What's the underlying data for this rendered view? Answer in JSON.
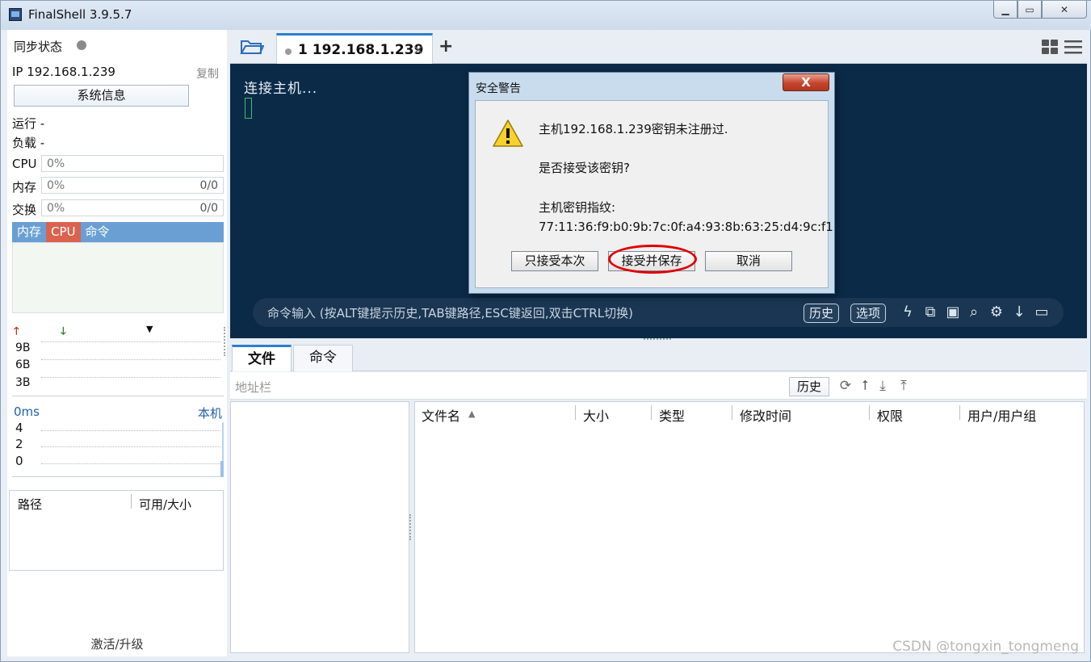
{
  "window": {
    "title": "FinalShell 3.9.5.7",
    "min_icon": "minimize-icon",
    "max_icon": "maximize-icon",
    "close_icon": "close-icon"
  },
  "sidebar": {
    "sync_label": "同步状态",
    "ip": "IP 192.168.1.239",
    "copy": "复制",
    "sysinfo_button": "系统信息",
    "run": "运行 -",
    "load": "负载 -",
    "meters": [
      {
        "label": "CPU",
        "pct": "0%",
        "ratio": ""
      },
      {
        "label": "内存",
        "pct": "0%",
        "ratio": "0/0"
      },
      {
        "label": "交换",
        "pct": "0%",
        "ratio": "0/0"
      }
    ],
    "proc_tabs": [
      "内存",
      "CPU",
      "命令"
    ],
    "net_yticks": [
      "9B",
      "6B",
      "3B"
    ],
    "ping_ms": "0ms",
    "ping_host": "本机",
    "ping_yticks": [
      "4",
      "2",
      "0"
    ],
    "disk_headers": [
      "路径",
      "可用/大小"
    ],
    "activate": "激活/升级"
  },
  "tabs": {
    "session_label": "1 192.168.1.239",
    "close": "×",
    "add": "+"
  },
  "terminal": {
    "text": "连接主机...",
    "cmd_placeholder": "命令输入 (按ALT键提示历史,TAB键路径,ESC键返回,双击CTRL切换)",
    "history_button": "历史",
    "options_button": "选项"
  },
  "bottom_tabs": [
    "文件",
    "命令"
  ],
  "address": {
    "placeholder": "地址栏",
    "history_button": "历史"
  },
  "file_columns": [
    "文件名",
    "大小",
    "类型",
    "修改时间",
    "权限",
    "用户/用户组"
  ],
  "watermark": "CSDN @tongxin_tongmeng",
  "dialog": {
    "title": "安全警告",
    "close": "X",
    "line1": "主机192.168.1.239密钥未注册过.",
    "line2": "是否接受该密钥?",
    "line3": "主机密钥指纹:",
    "line4": "77:11:36:f9:b0:9b:7c:0f:a4:93:8b:63:25:d4:9c:f1",
    "buttons": [
      "只接受本次",
      "接受并保存",
      "取消"
    ]
  },
  "colors": {
    "terminal_bg": "#0b2a48",
    "accent": "#2b7fd0",
    "highlight_ring": "#e00000",
    "cpu_tab": "#d9634f",
    "proc_tabs": "#6a9fd4"
  }
}
